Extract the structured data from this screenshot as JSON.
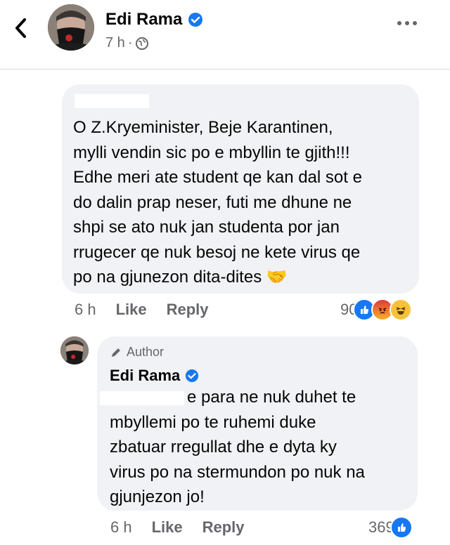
{
  "header": {
    "name": "Edi Rama",
    "time": "7 h",
    "separator": "·"
  },
  "comment": {
    "text": "O Z.Kryeminister, Beje Karantinen,\nmylli vendin sic po e mbyllin te gjith!!!\nEdhe meri ate student qe kan dal sot e\ndo dalin prap neser, futi me dhune ne\nshpi se ato nuk jan studenta por jan\nrrugecer qe nuk besoj ne kete virus qe\npo na gjunezon dita-dites 🤝",
    "time": "6 h",
    "like": "Like",
    "reply": "Reply",
    "reaction_count": "90",
    "reactions": [
      "like",
      "angry",
      "haha"
    ]
  },
  "reply": {
    "badge": "Author",
    "name": "Edi Rama",
    "text": "e para ne nuk duhet te\nmbyllemi po te ruhemi duke\nzbatuar rregullat dhe e dyta ky\nvirus po na stermundon po nuk na\ngjunjezon jo!",
    "time": "6 h",
    "like": "Like",
    "reply": "Reply",
    "reaction_count": "369",
    "reactions": [
      "like"
    ]
  },
  "colors": {
    "verified": "#1877f2",
    "bubble": "#f0f2f5",
    "secondary_text": "#65676b"
  }
}
